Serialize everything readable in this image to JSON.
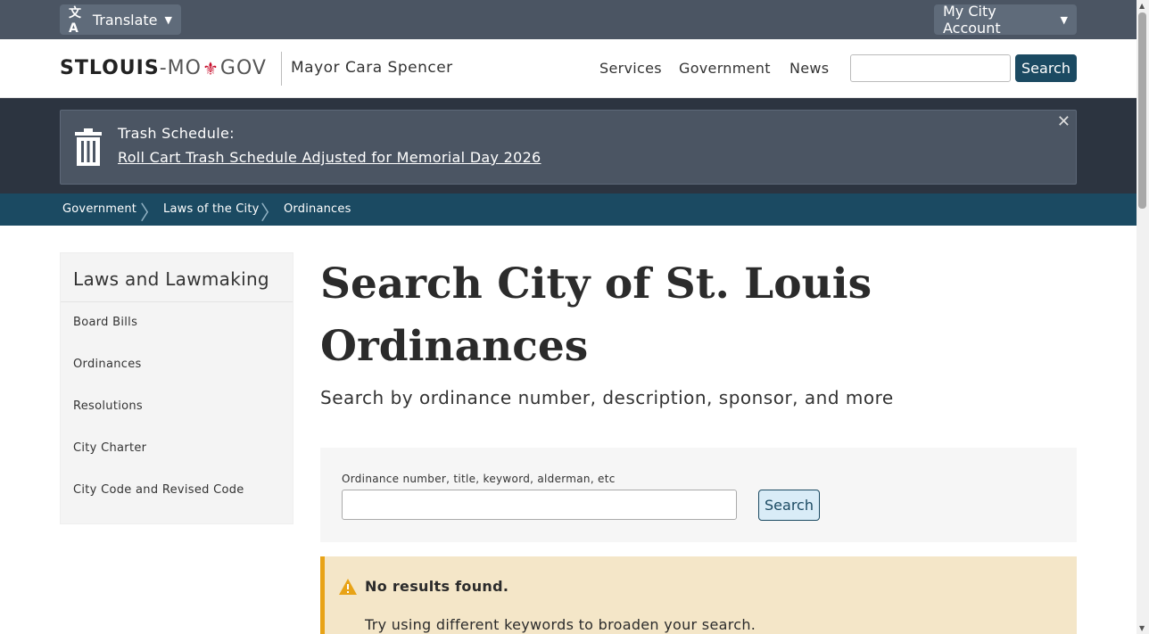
{
  "utility": {
    "translate_label": "Translate",
    "account_label": "My City Account"
  },
  "header": {
    "logo_stlouis": "STLOUIS",
    "logo_dash": "-",
    "logo_mo": "MO",
    "logo_gov": "GOV",
    "mayor": "Mayor Cara Spencer",
    "nav": [
      "Services",
      "Government",
      "News"
    ],
    "search_placeholder": "",
    "search_button": "Search"
  },
  "alert": {
    "label": "Trash Schedule:",
    "link": "Roll Cart Trash Schedule Adjusted for Memorial Day 2026",
    "close": "✕"
  },
  "breadcrumb": [
    "Government",
    "Laws of the City",
    "Ordinances"
  ],
  "sidebar": {
    "title": "Laws and Lawmaking",
    "items": [
      "Board Bills",
      "Ordinances",
      "Resolutions",
      "City Charter",
      "City Code and Revised Code"
    ]
  },
  "main": {
    "title": "Search City of St. Louis Ordinances",
    "subtitle": "Search by ordinance number, description, sponsor, and more",
    "search_label": "Ordinance number, title, keyword, alderman, etc",
    "search_value": "",
    "search_button": "Search"
  },
  "notice": {
    "title": "No results found.",
    "body": "Try using different keywords to broaden your search."
  },
  "colors": {
    "brand_dark": "#1b4a62",
    "utility_bar": "#4b5563",
    "alert_band": "#2c3440",
    "warning_accent": "#e8a317",
    "warning_bg": "#f4e6c8",
    "logo_red": "#c8102e"
  }
}
